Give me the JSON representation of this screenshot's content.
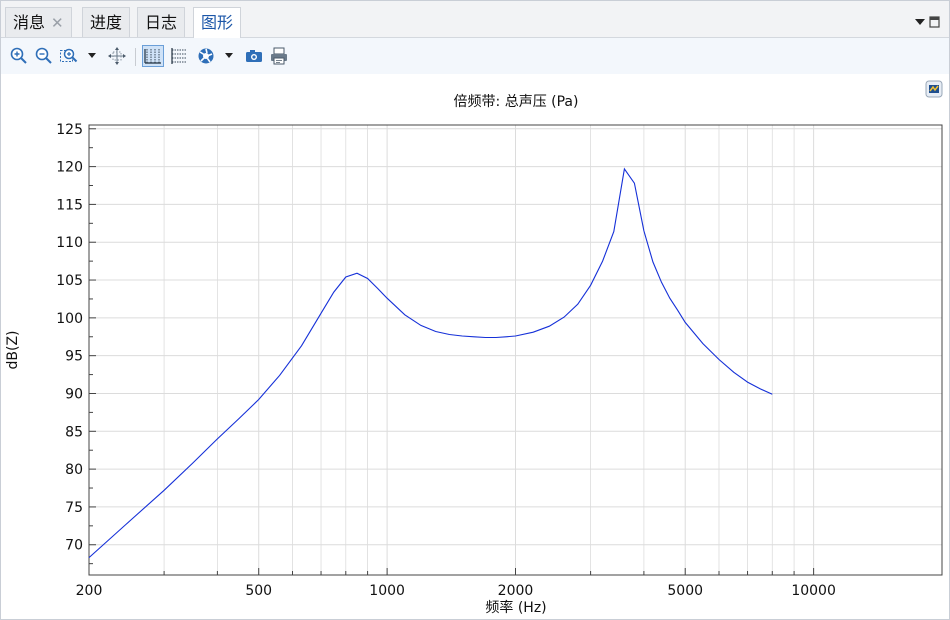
{
  "tabs": [
    {
      "label": "消息",
      "closable": true
    },
    {
      "label": "进度",
      "closable": false
    },
    {
      "label": "日志",
      "closable": false
    },
    {
      "label": "图形",
      "closable": false,
      "active": true
    }
  ],
  "toolbar": {
    "icons": [
      "zoom-in-icon",
      "zoom-out-icon",
      "zoom-box-icon",
      "zoom-extents-icon",
      "x-grid-icon",
      "y-grid-icon",
      "scene-light-icon",
      "camera-icon",
      "print-icon"
    ]
  },
  "colors": {
    "accent": "#1b56a8",
    "line": "#1530d8",
    "grid": "#dcdcdc"
  },
  "chart_data": {
    "type": "line",
    "title": "倍频带: 总声压 (Pa)",
    "xlabel": "频率 (Hz)",
    "ylabel": "dB(Z)",
    "xscale": "log",
    "xlim": [
      200,
      20000
    ],
    "ylim": [
      66,
      125.5
    ],
    "xticks": [
      200,
      500,
      1000,
      2000,
      5000,
      10000
    ],
    "xtick_labels": [
      "200",
      "500",
      "1000",
      "2000",
      "5000",
      "10000"
    ],
    "yticks": [
      70,
      75,
      80,
      85,
      90,
      95,
      100,
      105,
      110,
      115,
      120,
      125
    ],
    "ytick_labels": [
      "70",
      "75",
      "80",
      "85",
      "90",
      "95",
      "100",
      "105",
      "110",
      "115",
      "120",
      "125"
    ],
    "grid": true,
    "series": [
      {
        "x": [
          200,
          250,
          300,
          350,
          400,
          450,
          500,
          560,
          630,
          700,
          750,
          800,
          850,
          900,
          950,
          1000,
          1100,
          1200,
          1300,
          1400,
          1500,
          1600,
          1700,
          1800,
          1900,
          2000,
          2200,
          2400,
          2600,
          2800,
          3000,
          3200,
          3400,
          3600,
          3800,
          4000,
          4200,
          4400,
          4600,
          4800,
          5000,
          5500,
          6000,
          6500,
          7000,
          7500,
          8000
        ],
        "y": [
          68.3,
          73.2,
          77.2,
          80.8,
          84.0,
          86.7,
          89.2,
          92.4,
          96.3,
          100.6,
          103.4,
          105.4,
          105.9,
          105.2,
          103.9,
          102.6,
          100.4,
          99.0,
          98.2,
          97.8,
          97.6,
          97.5,
          97.4,
          97.4,
          97.5,
          97.6,
          98.1,
          98.9,
          100.1,
          101.8,
          104.3,
          107.5,
          111.4,
          119.7,
          117.8,
          111.5,
          107.4,
          104.7,
          102.6,
          101.0,
          99.4,
          96.6,
          94.5,
          92.8,
          91.5,
          90.6,
          89.9
        ]
      }
    ]
  }
}
